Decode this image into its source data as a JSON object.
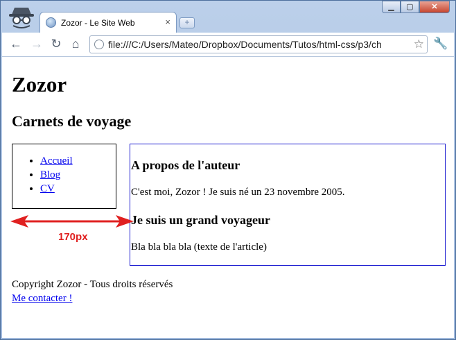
{
  "browser": {
    "tab_title": "Zozor - Le Site Web",
    "tab_close": "×",
    "new_tab": "+",
    "window_buttons": {
      "minimize": "▁",
      "maximize": "▢",
      "close": "✕"
    },
    "nav": {
      "back": "←",
      "forward": "→",
      "reload": "↻",
      "home": "⌂"
    },
    "url": "file:///C:/Users/Mateo/Dropbox/Documents/Tutos/html-css/p3/ch",
    "star": "☆",
    "wrench": "🔧",
    "icons": [
      "incognito-icon",
      "globe-icon",
      "page-icon",
      "star-icon",
      "wrench-icon"
    ]
  },
  "page": {
    "h1": "Zozor",
    "h2": "Carnets de voyage",
    "nav_items": [
      "Accueil",
      "Blog",
      "CV"
    ],
    "article": {
      "heading1": "A propos de l'auteur",
      "para1": "C'est moi, Zozor ! Je suis né un 23 novembre 2005.",
      "heading2": "Je suis un grand voyageur",
      "para2": "Bla bla bla bla (texte de l'article)"
    },
    "footer": {
      "copyright": "Copyright Zozor - Tous droits réservés",
      "contact": "Me contacter !"
    },
    "annotation": {
      "label": "170px",
      "color": "#e02020"
    }
  }
}
